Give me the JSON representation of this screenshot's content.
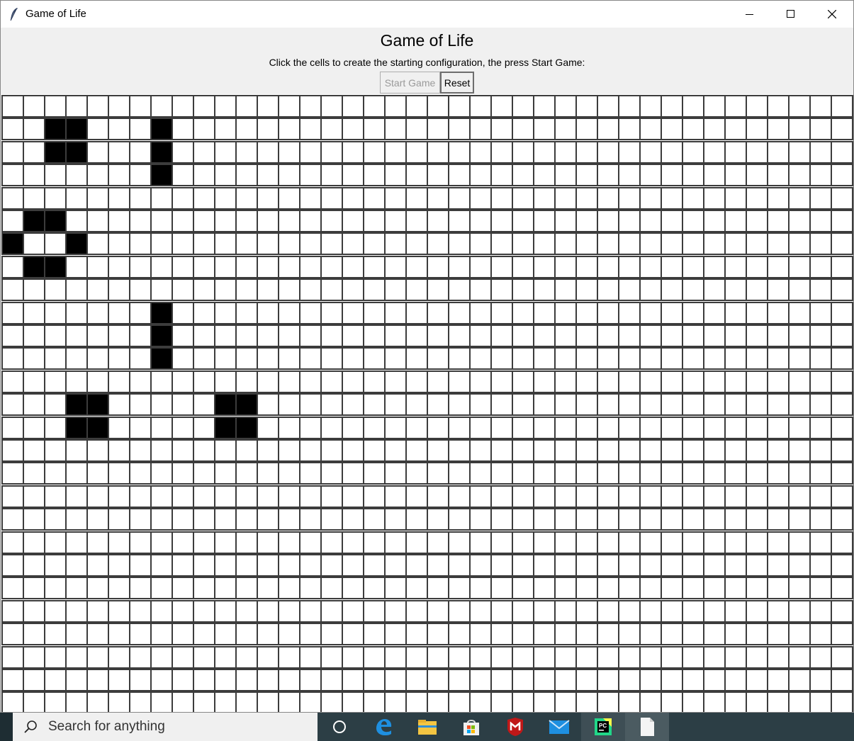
{
  "window": {
    "title": "Game of Life"
  },
  "header": {
    "heading": "Game of Life",
    "instructions": "Click the cells to create the starting configuration, the press Start Game:"
  },
  "controls": {
    "start_label": "Start Game",
    "start_enabled": false,
    "reset_label": "Reset"
  },
  "grid": {
    "columns": 40,
    "rows": 27,
    "cell_border_color": "#3c3c3c",
    "alive_color": "#000000",
    "dead_color": "#ffffff",
    "alive_cells": [
      [
        1,
        2
      ],
      [
        1,
        3
      ],
      [
        1,
        7
      ],
      [
        2,
        2
      ],
      [
        2,
        3
      ],
      [
        2,
        7
      ],
      [
        3,
        7
      ],
      [
        5,
        1
      ],
      [
        5,
        2
      ],
      [
        6,
        0
      ],
      [
        6,
        3
      ],
      [
        7,
        1
      ],
      [
        7,
        2
      ],
      [
        9,
        7
      ],
      [
        10,
        7
      ],
      [
        11,
        7
      ],
      [
        13,
        3
      ],
      [
        13,
        4
      ],
      [
        13,
        10
      ],
      [
        13,
        11
      ],
      [
        14,
        3
      ],
      [
        14,
        4
      ],
      [
        14,
        10
      ],
      [
        14,
        11
      ]
    ]
  },
  "taskbar": {
    "search_placeholder": "Search for anything",
    "icons": [
      "cortana-icon",
      "edge-icon",
      "file-explorer-icon",
      "store-icon",
      "mcafee-icon",
      "mail-icon",
      "pycharm-icon",
      "notepad-icon"
    ]
  }
}
